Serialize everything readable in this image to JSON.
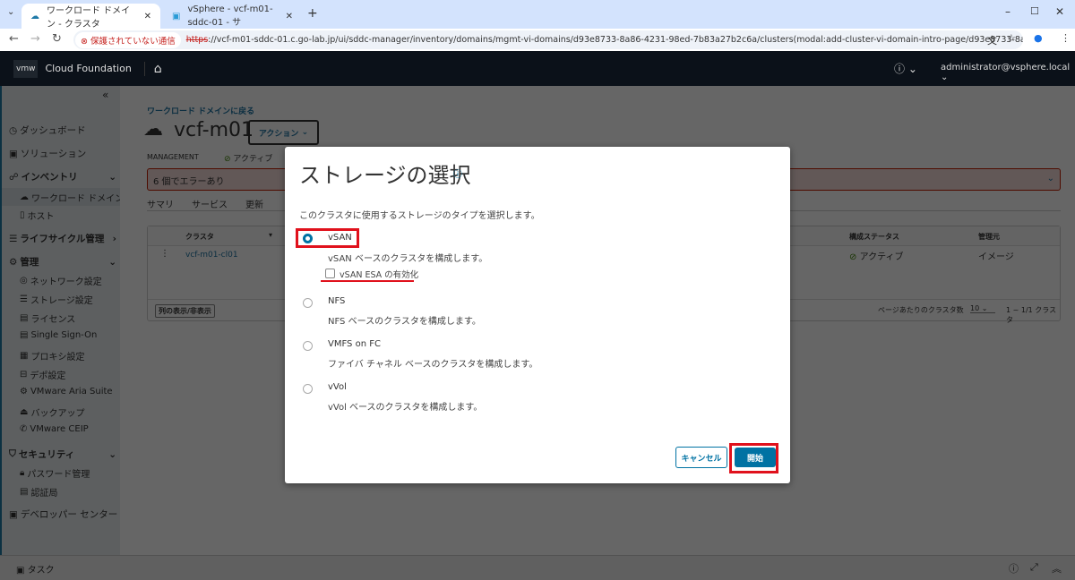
{
  "browser": {
    "tabs": [
      {
        "title": "ワークロード ドメイン - クラスタ"
      },
      {
        "title": "vSphere - vcf-m01-sddc-01 - サ"
      }
    ],
    "security_label": "保護されていない通信",
    "url_scheme": "https",
    "url_rest": "://vcf-m01-sddc-01.c.go-lab.jp/ui/sddc-manager/inventory/domains/mgmt-vi-domains/d93e8733-8a86-4231-98ed-7b83a27b2c6a/clusters(modal:add-cluster-vi-domain-intro-page/d93e8733-8a86-4231-98ed-7b83a27..."
  },
  "header": {
    "logo": "vmw",
    "product": "Cloud Foundation",
    "user": "administrator@vsphere.local"
  },
  "sidebar": {
    "items": [
      {
        "label": "ダッシュボード"
      },
      {
        "label": "ソリューション"
      },
      {
        "label": "インベントリ"
      },
      {
        "label": "ワークロード ドメイン"
      },
      {
        "label": "ホスト"
      },
      {
        "label": "ライフサイクル管理"
      },
      {
        "label": "管理"
      },
      {
        "label": "ネットワーク設定"
      },
      {
        "label": "ストレージ設定"
      },
      {
        "label": "ライセンス"
      },
      {
        "label": "Single Sign-On"
      },
      {
        "label": "プロキシ設定"
      },
      {
        "label": "デポ設定"
      },
      {
        "label": "VMware Aria Suite"
      },
      {
        "label": "バックアップ"
      },
      {
        "label": "VMware CEIP"
      },
      {
        "label": "セキュリティ"
      },
      {
        "label": "パスワード管理"
      },
      {
        "label": "認証局"
      },
      {
        "label": "デベロッパー センター"
      }
    ]
  },
  "page": {
    "back_link": "ワークロード ドメインに戻る",
    "title": "vcf-m01",
    "actions": "アクション",
    "type": "MANAGEMENT",
    "status": "アクティブ",
    "error": "6 個でエラーあり",
    "tabs": [
      "サマリ",
      "サービス",
      "更新"
    ],
    "table": {
      "headers": [
        "クラスタ",
        "構成ステータス",
        "管理元"
      ],
      "rows": [
        [
          "vcf-m01-cl01",
          "アクティブ",
          "イメージ"
        ]
      ]
    },
    "columns_btn": "列の表示/非表示",
    "per_page_label": "ページあたりのクラスタ数",
    "per_page": "10",
    "range": "1 ~ 1/1 クラスタ"
  },
  "modal": {
    "title": "ストレージの選択",
    "intro": "このクラスタに使用するストレージのタイプを選択します。",
    "options": [
      {
        "label": "vSAN",
        "desc": "vSAN ベースのクラスタを構成します。"
      },
      {
        "label": "NFS",
        "desc": "NFS ベースのクラスタを構成します。"
      },
      {
        "label": "VMFS on FC",
        "desc": "ファイバ チャネル ベースのクラスタを構成します。"
      },
      {
        "label": "vVol",
        "desc": "vVol ベースのクラスタを構成します。"
      }
    ],
    "esa_label": "vSAN ESA の有効化",
    "cancel": "キャンセル",
    "start": "開始"
  },
  "taskbar": {
    "label": "タスク"
  }
}
